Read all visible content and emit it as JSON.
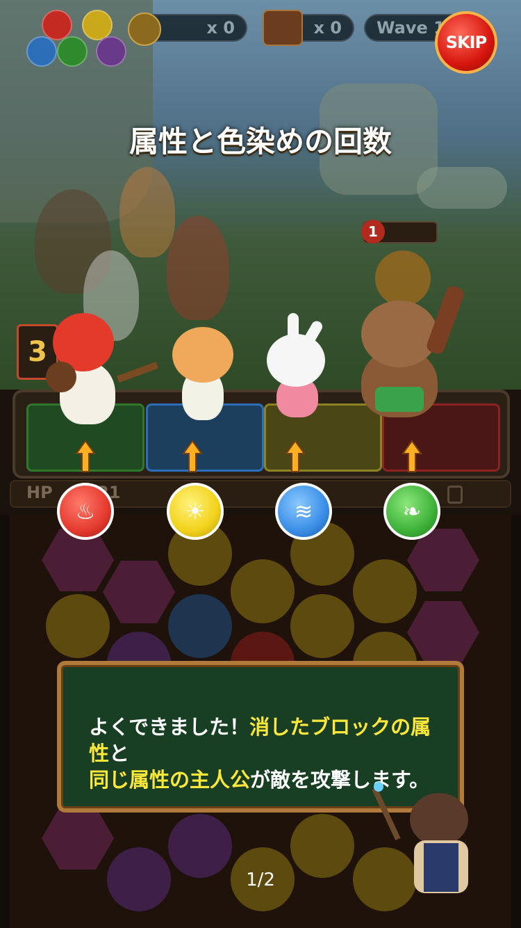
{
  "hud": {
    "coin_count": "x 0",
    "chest_count": "x 0",
    "wave_label": "Wave 1",
    "skip_label": "SKIP"
  },
  "tutorial": {
    "title": "属性と色染めの回数",
    "message_parts": [
      {
        "text": "よくできました！",
        "highlight": false
      },
      {
        "text": "消したブロックの属性",
        "highlight": true
      },
      {
        "text": "と",
        "highlight": false
      },
      {
        "text": "同じ属性の主人公",
        "highlight": true
      },
      {
        "text": "が敵を攻撃します。",
        "highlight": false
      }
    ],
    "page_indicator": "1/2"
  },
  "enemy": {
    "turn_counter": "1"
  },
  "team": {
    "side_counter": "3",
    "hp_label": "HP",
    "hp_value": "21",
    "heroes": [
      {
        "name": "red-hair-boy",
        "element": "fire",
        "color": "#e53a2f"
      },
      {
        "name": "orange-cat",
        "element": "light",
        "color": "#f2d21b"
      },
      {
        "name": "white-rabbit",
        "element": "water",
        "color": "#3a8ee6"
      },
      {
        "name": "brown-sloth",
        "element": "wind",
        "color": "#3fb23a"
      }
    ]
  },
  "element_orbs": [
    {
      "element": "fire",
      "icon": "flame-icon",
      "color": "#e53a2f"
    },
    {
      "element": "light",
      "icon": "sun-swirl-icon",
      "color": "#f2d21b"
    },
    {
      "element": "water",
      "icon": "wave-icon",
      "color": "#3a8ee6"
    },
    {
      "element": "wind",
      "icon": "leaf-icon",
      "color": "#3fb23a"
    }
  ],
  "colors": {
    "dialog_bg": "#183f24",
    "dialog_border": "#b07a3a",
    "highlight": "#ffe83a",
    "skip_red": "#d6160e"
  }
}
